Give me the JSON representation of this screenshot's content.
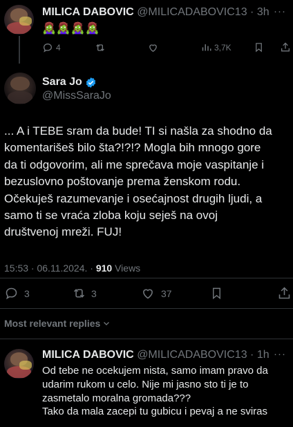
{
  "top_tweet": {
    "name": "MILICA DABOVIC",
    "handle": "@MILICADABOVIC13",
    "time": "· 3h",
    "more": "···",
    "text": "🧟‍♀️🧟‍♀️🧟‍♀️🧟‍♀️",
    "replies": "4",
    "views": "3,7K"
  },
  "main_tweet": {
    "name": "Sara Jo",
    "handle": "@MissSaraJo",
    "lines": [
      "... A i TEBE sram da bude! TI si našla za shodno da",
      "komentarišeš bilo šta?!?!? Mogla bih mnogo gore",
      "da ti odgovorim, ali me sprečava moje vaspitanje i",
      "bezuslovno poštovanje prema ženskom rodu.",
      "Očekuješ razumevanje i osećajnost drugih ljudi, a",
      "samo ti se vraća zloba koju seješ na ovoj",
      "društvenoj mreži. FUJ!"
    ],
    "datetime": "15:53 · 06.11.2024. · ",
    "views_count": "910",
    "views_label": " Views",
    "replies": "3",
    "reposts": "3",
    "likes": "37"
  },
  "replies_section": {
    "label": "Most relevant replies"
  },
  "reply_tweet": {
    "name": "MILICA DABOVIC",
    "handle": "@MILICADABOVIC13",
    "time": "· 1h",
    "more": "···",
    "lines": [
      "Od tebe ne ocekujem nista, samo imam pravo da",
      "udarim rukom u celo. Nije mi jasno sto ti je to",
      "zasmetalo moralna gromada???",
      "Tako da mala zacepi tu gubicu i pevaj a ne sviras"
    ]
  },
  "colors": {
    "background": "#000000",
    "text": "#e7e9ea",
    "muted": "#71767b",
    "verified": "#1d9bf0"
  }
}
